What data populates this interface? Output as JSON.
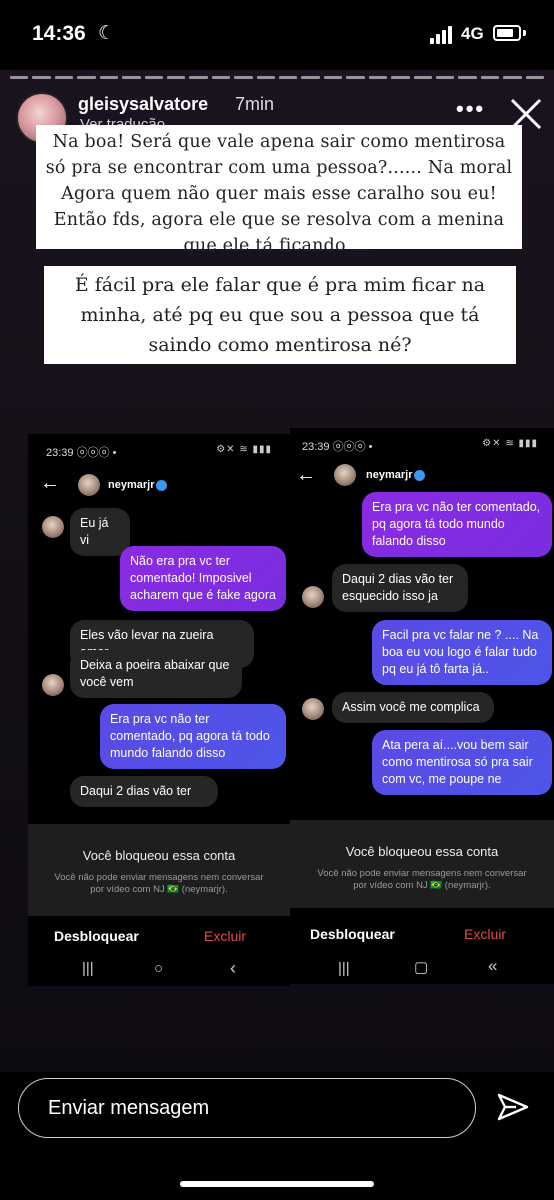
{
  "status_bar": {
    "time": "14:36",
    "network": "4G"
  },
  "story": {
    "username": "gleisysalvatore",
    "time_ago": "7min",
    "translate_label": "Ver tradução",
    "caption1": "Na boa!  Será que vale apena sair como mentirosa só pra se encontrar com uma pessoa?...... Na moral Agora quem não quer mais esse caralho sou eu! Então fds,  agora ele que se resolva com a menina que ele tá ficando ....",
    "caption2": "É fácil pra ele falar que é pra mim ficar na minha, até pq eu que sou a pessoa que tá saindo como mentirosa né?"
  },
  "screenshot_left": {
    "time": "23:39",
    "contact": "neymarjr",
    "messages": [
      {
        "side": "received",
        "text": "Eu já vi"
      },
      {
        "side": "sent",
        "text": "Não era pra vc ter comentado! Imposivel acharem que é fake agora"
      },
      {
        "side": "received",
        "text": "Eles vão levar na zueira amor"
      },
      {
        "side": "received",
        "text": "Deixa a poeira abaixar que você vem"
      },
      {
        "side": "sent",
        "text": "Era pra vc não ter comentado, pq agora tá todo mundo falando disso"
      },
      {
        "side": "received",
        "text": "Daqui 2 dias vão ter"
      }
    ],
    "blocked_title": "Você bloqueou essa conta",
    "blocked_sub": "Você não pode enviar mensagens nem conversar por vídeo com NJ 🇧🇷 (neymarjr).",
    "unblock_label": "Desbloquear",
    "delete_label": "Excluir",
    "nav": [
      "|||",
      "○",
      "‹"
    ]
  },
  "screenshot_right": {
    "time": "23:39",
    "contact": "neymarjr",
    "messages": [
      {
        "side": "sent",
        "text": "Era pra vc não ter comentado, pq agora tá todo mundo falando disso"
      },
      {
        "side": "received",
        "text": "Daqui 2 dias vão ter esquecido isso ja"
      },
      {
        "side": "sent",
        "text": "Facil pra vc falar ne ? .... Na boa eu vou logo é falar tudo pq eu já tô farta já.."
      },
      {
        "side": "received",
        "text": "Assim você me complica"
      },
      {
        "side": "sent",
        "text": "Ata pera aí....vou bem sair como mentirosa só pra sair com vc, me poupe ne"
      }
    ],
    "blocked_title": "Você bloqueou essa conta",
    "blocked_sub": "Você não pode enviar mensagens nem conversar por vídeo com NJ 🇧🇷 (neymarjr).",
    "unblock_label": "Desbloquear",
    "delete_label": "Excluir",
    "nav": [
      "|||",
      "▢",
      "«"
    ]
  },
  "reply": {
    "placeholder": "Enviar mensagem"
  },
  "icons": [
    "moon-icon",
    "signal-icon",
    "battery-icon",
    "more-icon",
    "close-icon",
    "send-icon",
    "back-arrow-icon",
    "verified-icon"
  ]
}
